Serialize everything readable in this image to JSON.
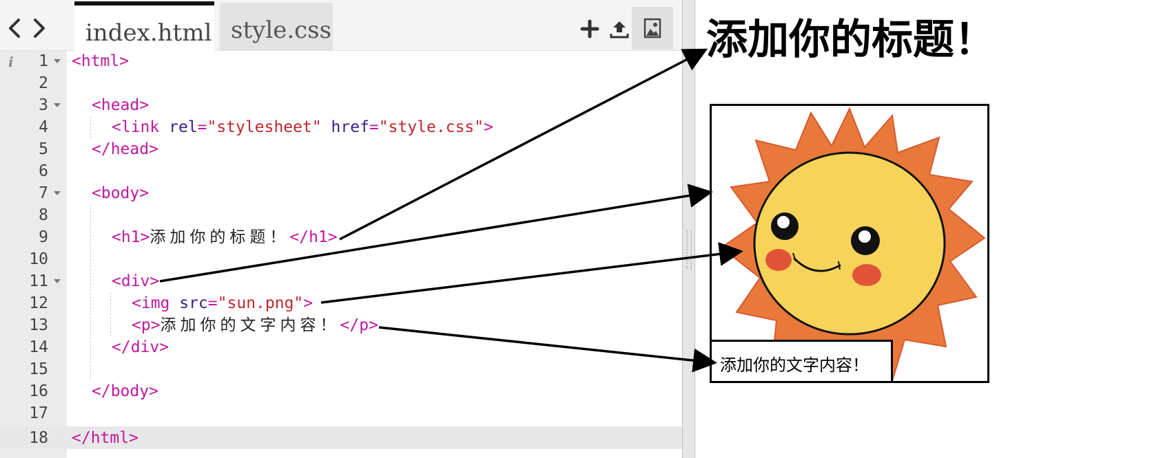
{
  "tabs": [
    {
      "label": "index.html",
      "active": true
    },
    {
      "label": "style.css",
      "active": false
    }
  ],
  "toolbar": {
    "back_icon": "chevron-left-icon",
    "forward_icon": "chevron-right-icon",
    "add_icon": "plus-icon",
    "upload_icon": "upload-icon",
    "image_icon": "image-icon"
  },
  "editor": {
    "info_icon": "i",
    "line_numbers": [
      "1",
      "2",
      "3",
      "4",
      "5",
      "6",
      "7",
      "8",
      "9",
      "10",
      "11",
      "12",
      "13",
      "14",
      "15",
      "16",
      "17",
      "18"
    ],
    "foldable_lines": [
      1,
      3,
      7,
      11
    ],
    "active_line": 18,
    "lines": {
      "l1": {
        "open": "<html>"
      },
      "l3": {
        "open": "<head>"
      },
      "l4": {
        "tag": "<link",
        "attr1": "rel",
        "eq1": "=",
        "val1": "\"stylesheet\"",
        "attr2": "href",
        "eq2": "=",
        "val2": "\"style.css\"",
        "close": ">"
      },
      "l5": {
        "close": "</head>"
      },
      "l7": {
        "open": "<body>"
      },
      "l9": {
        "open": "<h1>",
        "text": "添加你的标题！",
        "close": "</h1>"
      },
      "l11": {
        "open": "<div>"
      },
      "l12": {
        "tag": "<img",
        "attr": "src",
        "eq": "=",
        "val": "\"sun.png\"",
        "close": ">"
      },
      "l13": {
        "open": "<p>",
        "text": "添加你的文字内容！",
        "close": "</p>"
      },
      "l14": {
        "close": "</div>"
      },
      "l16": {
        "close": "</body>"
      },
      "l18": {
        "close": "</html>"
      }
    }
  },
  "preview": {
    "heading": "添加你的标题！",
    "image_name": "sun-image",
    "paragraph": "添加你的文字内容！"
  },
  "colors": {
    "tag": "#c2179f",
    "attribute": "#3a1c8f",
    "string": "#c0262d",
    "sun_rays": "#e8793a",
    "sun_face": "#f8d35a",
    "cheeks": "#e2543a"
  }
}
